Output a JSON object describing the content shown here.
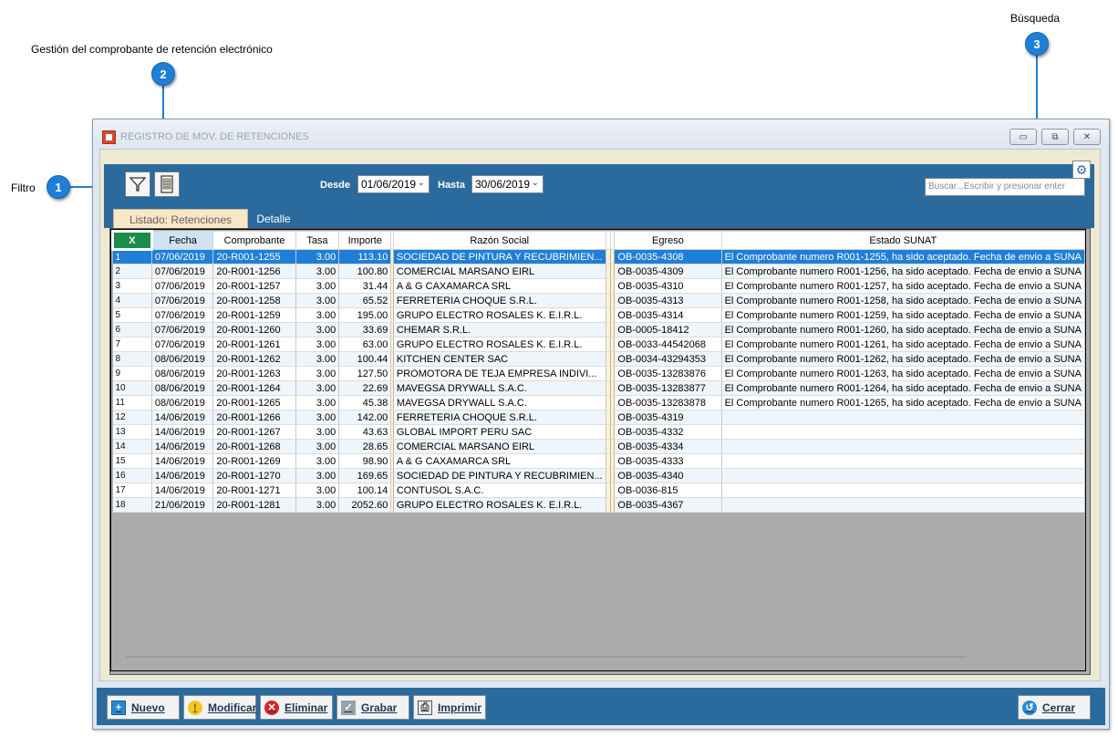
{
  "annotations": {
    "filtro": "Filtro",
    "gestion": "Gestión del comprobante de retención electrónico",
    "busqueda": "Búsqueda",
    "n1": "1",
    "n2": "2",
    "n3": "3"
  },
  "window": {
    "title": "REGISTRO DE MOV. DE RETENCIONES",
    "min": "▭",
    "max": "⧉",
    "close": "✕"
  },
  "toolbar": {
    "desde_label": "Desde",
    "desde_value": "01/06/2019",
    "hasta_label": "Hasta",
    "hasta_value": "30/06/2019",
    "search_placeholder": "Buscar...Escribir y presionar enter",
    "filter_icon": "filter-icon",
    "document_icon": "document-icon",
    "gear_icon": "gear-icon"
  },
  "tabs": {
    "listado": "Listado: Retenciones",
    "detalle": "Detalle"
  },
  "grid": {
    "headers": {
      "x": "X",
      "fecha": "Fecha",
      "comprobante": "Comprobante",
      "tasa": "Tasa",
      "importe": "Importe",
      "razon": "Razón Social",
      "egreso": "Egreso",
      "estado": "Estado SUNAT"
    },
    "rows": [
      {
        "n": "1",
        "fecha": "07/06/2019",
        "comp": "20-R001-1255",
        "tasa": "3.00",
        "imp": "113.10",
        "razon": "SOCIEDAD DE PINTURA Y RECUBRIMIEN...",
        "egreso": "OB-0035-4308",
        "estado": "El Comprobante  numero R001-1255, ha sido aceptado. Fecha de envio a SUNA"
      },
      {
        "n": "2",
        "fecha": "07/06/2019",
        "comp": "20-R001-1256",
        "tasa": "3.00",
        "imp": "100.80",
        "razon": "COMERCIAL MARSANO EIRL",
        "egreso": "OB-0035-4309",
        "estado": "El Comprobante  numero R001-1256, ha sido aceptado. Fecha de envio a SUNA"
      },
      {
        "n": "3",
        "fecha": "07/06/2019",
        "comp": "20-R001-1257",
        "tasa": "3.00",
        "imp": "31.44",
        "razon": "A & G CAXAMARCA SRL",
        "egreso": "OB-0035-4310",
        "estado": "El Comprobante  numero R001-1257, ha sido aceptado. Fecha de envio a SUNA"
      },
      {
        "n": "4",
        "fecha": "07/06/2019",
        "comp": "20-R001-1258",
        "tasa": "3.00",
        "imp": "65.52",
        "razon": "FERRETERIA CHOQUE S.R.L.",
        "egreso": "OB-0035-4313",
        "estado": "El Comprobante  numero R001-1258, ha sido aceptado. Fecha de envio a SUNA"
      },
      {
        "n": "5",
        "fecha": "07/06/2019",
        "comp": "20-R001-1259",
        "tasa": "3.00",
        "imp": "195.00",
        "razon": "GRUPO ELECTRO ROSALES K. E.I.R.L.",
        "egreso": "OB-0035-4314",
        "estado": "El Comprobante  numero R001-1259, ha sido aceptado. Fecha de envio a SUNA"
      },
      {
        "n": "6",
        "fecha": "07/06/2019",
        "comp": "20-R001-1260",
        "tasa": "3.00",
        "imp": "33.69",
        "razon": "CHEMAR S.R.L.",
        "egreso": "OB-0005-18412",
        "estado": "El Comprobante  numero R001-1260, ha sido aceptado. Fecha de envio a SUNA"
      },
      {
        "n": "7",
        "fecha": "07/06/2019",
        "comp": "20-R001-1261",
        "tasa": "3.00",
        "imp": "63.00",
        "razon": "GRUPO ELECTRO ROSALES K. E.I.R.L.",
        "egreso": "OB-0033-44542068",
        "estado": "El Comprobante  numero R001-1261, ha sido aceptado. Fecha de envio a SUNA"
      },
      {
        "n": "8",
        "fecha": "08/06/2019",
        "comp": "20-R001-1262",
        "tasa": "3.00",
        "imp": "100.44",
        "razon": "KITCHEN CENTER SAC",
        "egreso": "OB-0034-43294353",
        "estado": "El Comprobante  numero R001-1262, ha sido aceptado. Fecha de envio a SUNA"
      },
      {
        "n": "9",
        "fecha": "08/06/2019",
        "comp": "20-R001-1263",
        "tasa": "3.00",
        "imp": "127.50",
        "razon": "PROMOTORA DE TEJA EMPRESA INDIVI...",
        "egreso": "OB-0035-13283876",
        "estado": "El Comprobante  numero R001-1263, ha sido aceptado. Fecha de envio a SUNA"
      },
      {
        "n": "10",
        "fecha": "08/06/2019",
        "comp": "20-R001-1264",
        "tasa": "3.00",
        "imp": "22.69",
        "razon": "MAVEGSA DRYWALL S.A.C.",
        "egreso": "OB-0035-13283877",
        "estado": "El Comprobante  numero R001-1264, ha sido aceptado. Fecha de envio a SUNA"
      },
      {
        "n": "11",
        "fecha": "08/06/2019",
        "comp": "20-R001-1265",
        "tasa": "3.00",
        "imp": "45.38",
        "razon": "MAVEGSA DRYWALL S.A.C.",
        "egreso": "OB-0035-13283878",
        "estado": "El Comprobante  numero R001-1265, ha sido aceptado. Fecha de envio a SUNA"
      },
      {
        "n": "12",
        "fecha": "14/06/2019",
        "comp": "20-R001-1266",
        "tasa": "3.00",
        "imp": "142.00",
        "razon": "FERRETERIA CHOQUE S.R.L.",
        "egreso": "OB-0035-4319",
        "estado": ""
      },
      {
        "n": "13",
        "fecha": "14/06/2019",
        "comp": "20-R001-1267",
        "tasa": "3.00",
        "imp": "43.63",
        "razon": "GLOBAL IMPORT PERU SAC",
        "egreso": "OB-0035-4332",
        "estado": ""
      },
      {
        "n": "14",
        "fecha": "14/06/2019",
        "comp": "20-R001-1268",
        "tasa": "3.00",
        "imp": "28.65",
        "razon": "COMERCIAL MARSANO EIRL",
        "egreso": "OB-0035-4334",
        "estado": ""
      },
      {
        "n": "15",
        "fecha": "14/06/2019",
        "comp": "20-R001-1269",
        "tasa": "3.00",
        "imp": "98.90",
        "razon": "A & G CAXAMARCA SRL",
        "egreso": "OB-0035-4333",
        "estado": ""
      },
      {
        "n": "16",
        "fecha": "14/06/2019",
        "comp": "20-R001-1270",
        "tasa": "3.00",
        "imp": "169.65",
        "razon": "SOCIEDAD DE PINTURA Y RECUBRIMIEN...",
        "egreso": "OB-0035-4340",
        "estado": ""
      },
      {
        "n": "17",
        "fecha": "14/06/2019",
        "comp": "20-R001-1271",
        "tasa": "3.00",
        "imp": "100.14",
        "razon": "CONTUSOL S.A.C.",
        "egreso": "OB-0036-815",
        "estado": ""
      },
      {
        "n": "18",
        "fecha": "21/06/2019",
        "comp": "20-R001-1281",
        "tasa": "3.00",
        "imp": "2052.60",
        "razon": "GRUPO ELECTRO ROSALES K. E.I.R.L.",
        "egreso": "OB-0035-4367",
        "estado": ""
      }
    ]
  },
  "buttons": {
    "nuevo": "Nuevo",
    "modificar": "Modificar",
    "eliminar": "Eliminar",
    "grabar": "Grabar",
    "imprimir": "Imprimir",
    "cerrar": "Cerrar"
  },
  "colors": {
    "accent": "#2a6a9c",
    "selected_row": "#1f7fd6",
    "callout": "#1f7fd6"
  }
}
